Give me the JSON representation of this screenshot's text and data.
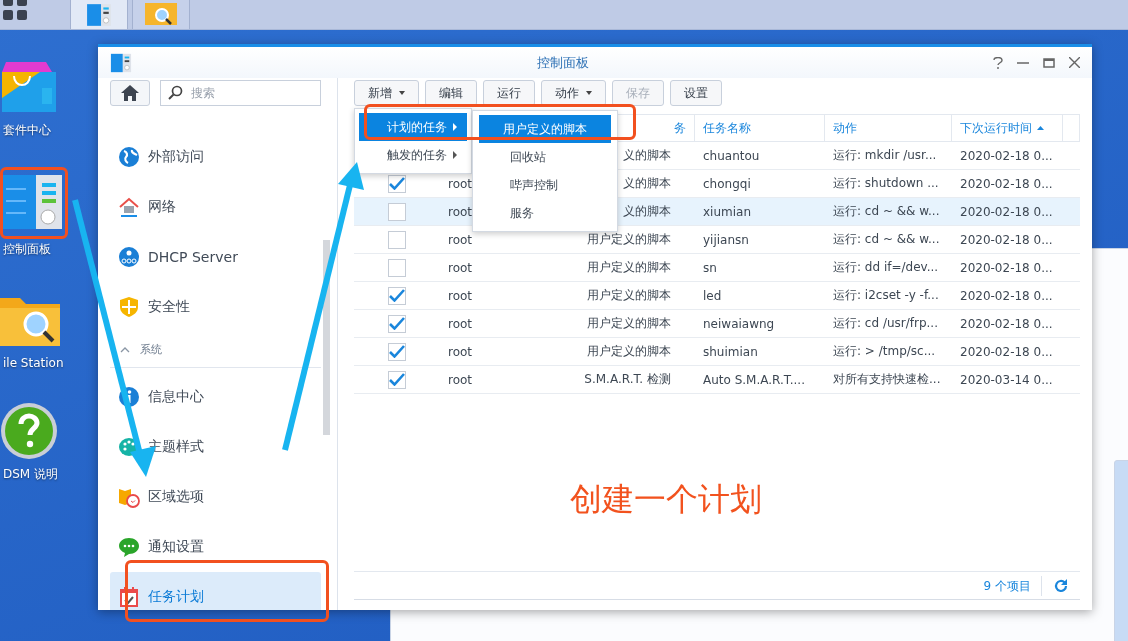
{
  "taskbar": {
    "buttons": [
      {
        "selected": true
      },
      {
        "selected": false
      }
    ]
  },
  "desktop_icons": [
    {
      "kind": "package",
      "label": "套件中心"
    },
    {
      "kind": "panel",
      "label": "控制面板"
    },
    {
      "kind": "folder",
      "label": "ile Station"
    },
    {
      "kind": "help",
      "label": "DSM 说明"
    }
  ],
  "window": {
    "title": "控制面板"
  },
  "sidebar": {
    "search": {
      "placeholder": "搜索"
    },
    "items": [
      {
        "kind": "item",
        "label": "外部访问",
        "selected": false
      },
      {
        "kind": "item",
        "label": "网络",
        "selected": false
      },
      {
        "kind": "item",
        "label": "DHCP Server",
        "selected": false
      },
      {
        "kind": "item",
        "label": "安全性",
        "selected": false
      },
      {
        "kind": "section",
        "label": "系统",
        "expanded": true
      },
      {
        "kind": "item",
        "label": "信息中心",
        "selected": false
      },
      {
        "kind": "item",
        "label": "主题样式",
        "selected": false
      },
      {
        "kind": "item",
        "label": "区域选项",
        "selected": false
      },
      {
        "kind": "item",
        "label": "通知设置",
        "selected": false
      },
      {
        "kind": "item",
        "label": "任务计划",
        "selected": true
      }
    ]
  },
  "toolbar": {
    "buttons": [
      {
        "label": "新增",
        "dropdown": true,
        "disabled": false
      },
      {
        "label": "编辑",
        "dropdown": false,
        "disabled": false
      },
      {
        "label": "运行",
        "dropdown": false,
        "disabled": false
      },
      {
        "label": "动作",
        "dropdown": true,
        "disabled": false
      },
      {
        "label": "保存",
        "dropdown": false,
        "disabled": true
      },
      {
        "label": "设置",
        "dropdown": false,
        "disabled": false
      }
    ]
  },
  "table": {
    "columns": [
      {
        "label": "务"
      },
      {
        "label": "任务名称"
      },
      {
        "label": "动作"
      },
      {
        "label": "下次运行时间",
        "sort_ascending": true
      }
    ],
    "rows": [
      {
        "type": "义的脚本",
        "name": "chuantou",
        "action": "运行: mkdir /usr...",
        "next_run": "2020-02-18 0...",
        "selected": false
      },
      {
        "enabled": true,
        "user": "root",
        "type": "义的脚本",
        "name": "chongqi",
        "action": "运行: shutdown ...",
        "next_run": "2020-02-18 0...",
        "selected": false
      },
      {
        "enabled": false,
        "user": "root",
        "type": "义的脚本",
        "name": "xiumian",
        "action": "运行: cd ~ && w...",
        "next_run": "2020-02-18 0...",
        "selected": true
      },
      {
        "enabled": false,
        "user": "root",
        "type": "用户定义的脚本",
        "name": "yijiansn",
        "action": "运行: cd ~ && w...",
        "next_run": "2020-02-18 0...",
        "selected": false
      },
      {
        "enabled": false,
        "user": "root",
        "type": "用户定义的脚本",
        "name": "sn",
        "action": "运行: dd if=/dev...",
        "next_run": "2020-02-18 0...",
        "selected": false
      },
      {
        "enabled": true,
        "user": "root",
        "type": "用户定义的脚本",
        "name": "led",
        "action": "运行: i2cset -y -f...",
        "next_run": "2020-02-18 0...",
        "selected": false
      },
      {
        "enabled": true,
        "user": "root",
        "type": "用户定义的脚本",
        "name": "neiwaiawng",
        "action": "运行: cd /usr/frp...",
        "next_run": "2020-02-18 0...",
        "selected": false
      },
      {
        "enabled": true,
        "user": "root",
        "type": "用户定义的脚本",
        "name": "shuimian",
        "action": "运行: > /tmp/sc...",
        "next_run": "2020-02-18 0...",
        "selected": false
      },
      {
        "enabled": true,
        "user": "root",
        "type": "S.M.A.R.T. 检测",
        "name": "Auto S.M.A.R.T....",
        "action": "对所有支持快速检...",
        "next_run": "2020-03-14 0...",
        "selected": false
      }
    ]
  },
  "footer": {
    "count": "9 个项目"
  },
  "menu": {
    "items": [
      {
        "label": "计划的任务",
        "selected": true,
        "submenu": true
      },
      {
        "label": "触发的任务",
        "selected": false,
        "submenu": true
      }
    ],
    "submenu": [
      {
        "label": "用户定义的脚本",
        "selected": true
      },
      {
        "label": "回收站",
        "selected": false
      },
      {
        "label": "哔声控制",
        "selected": false
      },
      {
        "label": "服务",
        "selected": false
      }
    ]
  },
  "annotation": {
    "caption": "创建一个计划"
  }
}
